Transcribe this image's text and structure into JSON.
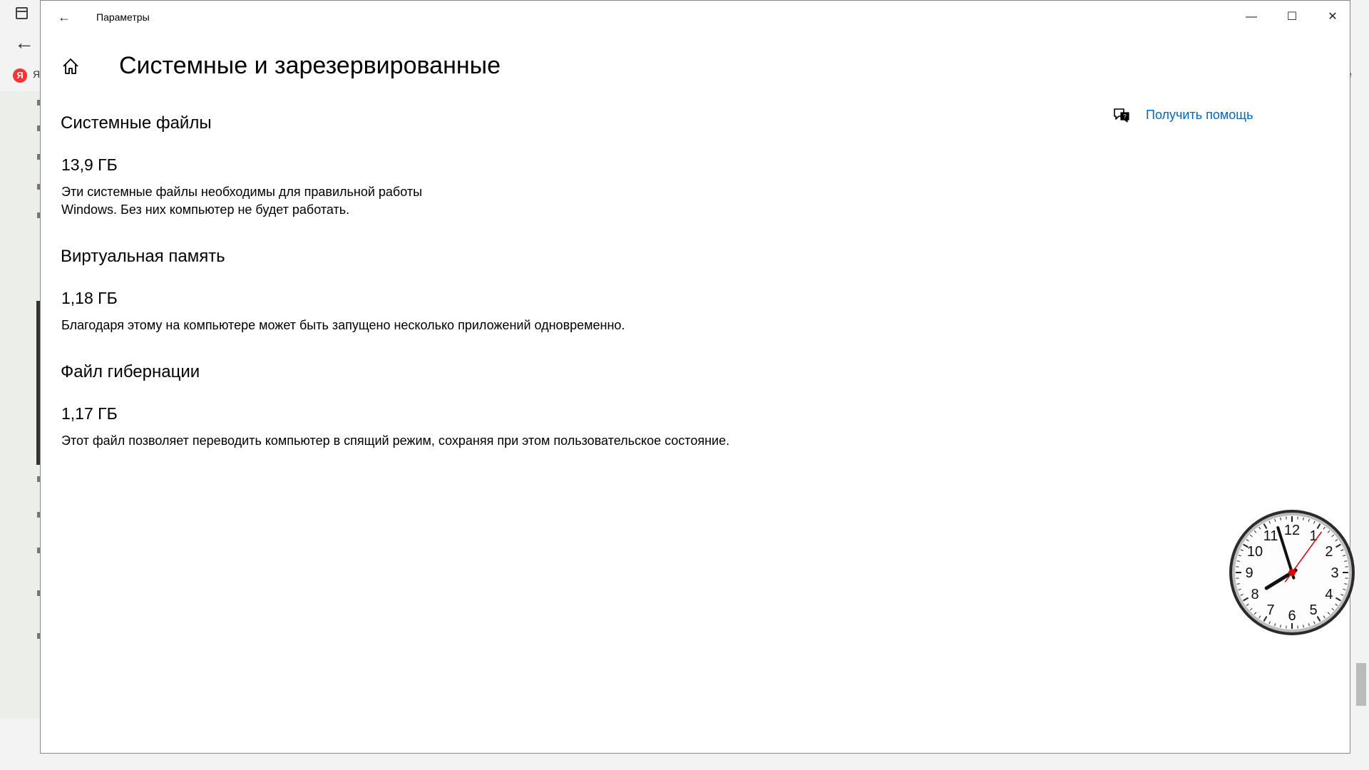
{
  "window": {
    "title": "Параметры",
    "back_label": "←",
    "minimize_label": "—",
    "maximize_label": "☐",
    "close_label": "✕"
  },
  "page": {
    "title": "Системные и зарезервированные",
    "help_label": "Получить помощь"
  },
  "sections": [
    {
      "title": "Системные файлы",
      "size": "13,9 ГБ",
      "description": "Эти системные файлы необходимы для правильной работы Windows. Без них компьютер не будет работать."
    },
    {
      "title": "Виртуальная память",
      "size": "1,18 ГБ",
      "description": "Благодаря этому на компьютере может быть запущено несколько приложений одновременно."
    },
    {
      "title": "Файл гибернации",
      "size": "1,17 ГБ",
      "description": "Этот файл позволяет переводить компьютер в спящий режим, сохраняя при этом пользовательское состояние."
    }
  ],
  "background": {
    "bookmark_fragment": "Я",
    "bookmark_right_fragment": "е"
  },
  "clock": {
    "numerals": [
      "12",
      "1",
      "2",
      "3",
      "4",
      "5",
      "6",
      "7",
      "8",
      "9",
      "10",
      "11"
    ],
    "time": {
      "hours": 7,
      "minutes": 57,
      "seconds": 6
    }
  },
  "colors": {
    "link": "#0067c0",
    "second_hand": "#e00000"
  }
}
